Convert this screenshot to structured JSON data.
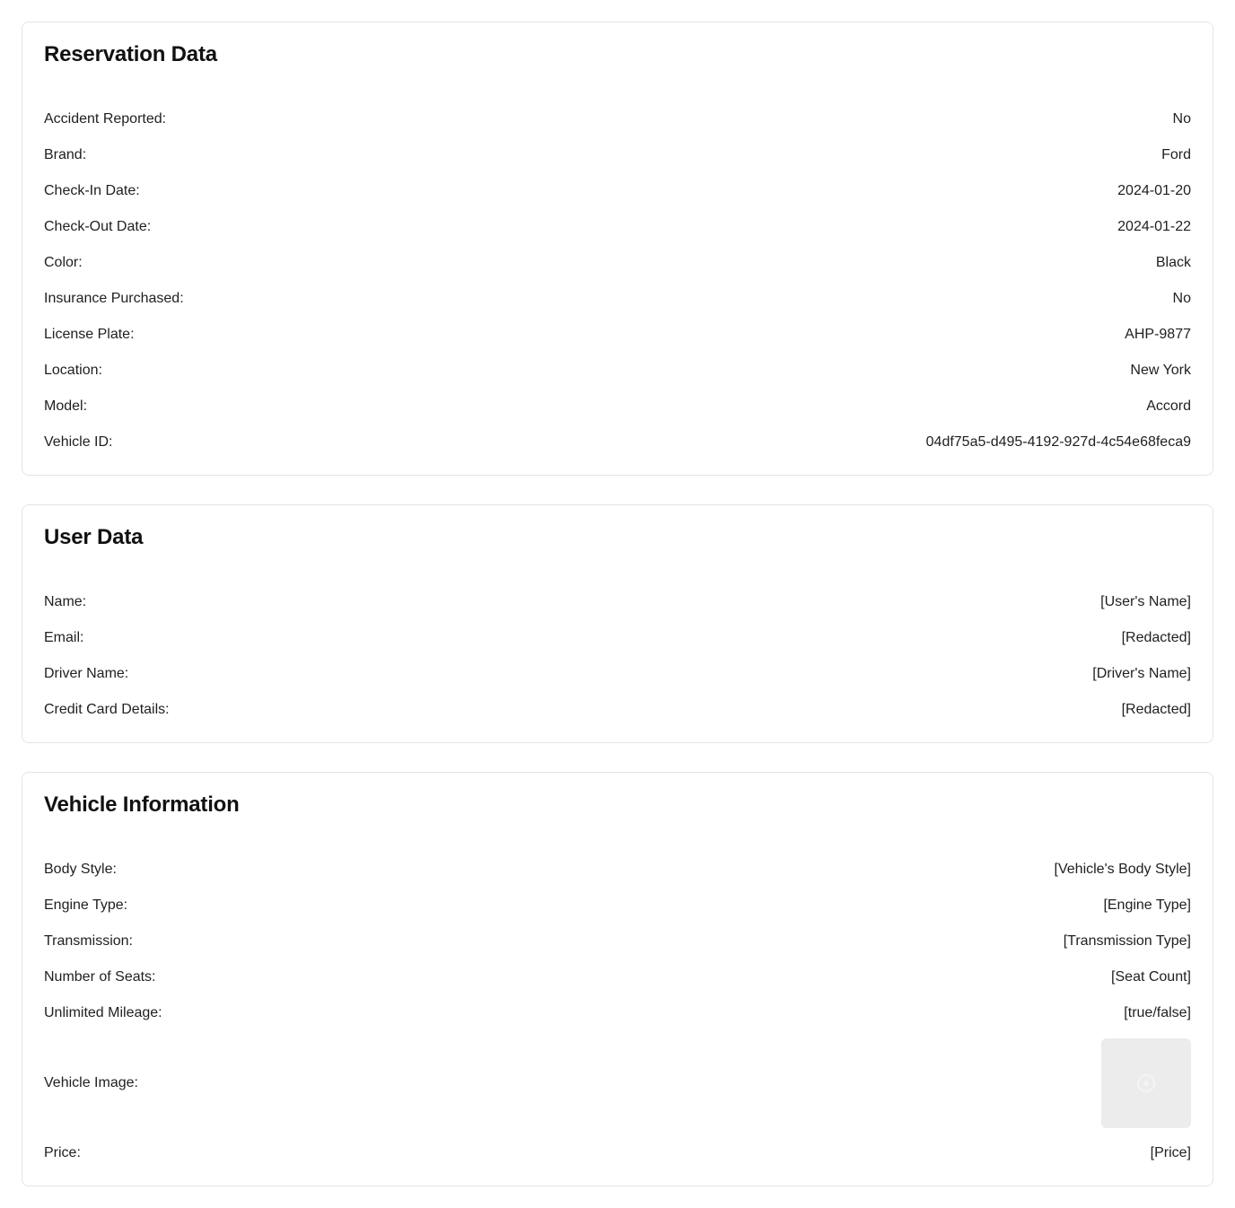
{
  "reservation": {
    "title": "Reservation Data",
    "rows": [
      {
        "label": "Accident Reported:",
        "value": "No"
      },
      {
        "label": "Brand:",
        "value": "Ford"
      },
      {
        "label": "Check-In Date:",
        "value": "2024-01-20"
      },
      {
        "label": "Check-Out Date:",
        "value": "2024-01-22"
      },
      {
        "label": "Color:",
        "value": "Black"
      },
      {
        "label": "Insurance Purchased:",
        "value": "No"
      },
      {
        "label": "License Plate:",
        "value": "AHP-9877"
      },
      {
        "label": "Location:",
        "value": "New York"
      },
      {
        "label": "Model:",
        "value": "Accord"
      },
      {
        "label": "Vehicle ID:",
        "value": "04df75a5-d495-4192-927d-4c54e68feca9"
      }
    ]
  },
  "user": {
    "title": "User Data",
    "rows": [
      {
        "label": "Name:",
        "value": "[User's Name]"
      },
      {
        "label": "Email:",
        "value": "[Redacted]"
      },
      {
        "label": "Driver Name:",
        "value": "[Driver's Name]"
      },
      {
        "label": "Credit Card Details:",
        "value": "[Redacted]"
      }
    ]
  },
  "vehicle": {
    "title": "Vehicle Information",
    "rows": [
      {
        "label": "Body Style:",
        "value": "[Vehicle's Body Style]"
      },
      {
        "label": "Engine Type:",
        "value": "[Engine Type]"
      },
      {
        "label": "Transmission:",
        "value": "[Transmission Type]"
      },
      {
        "label": "Number of Seats:",
        "value": "[Seat Count]"
      },
      {
        "label": "Unlimited Mileage:",
        "value": "[true/false]"
      }
    ],
    "image_label": "Vehicle Image:",
    "image_icon": "image-placeholder-icon",
    "price_label": "Price:",
    "price_value": "[Price]"
  }
}
